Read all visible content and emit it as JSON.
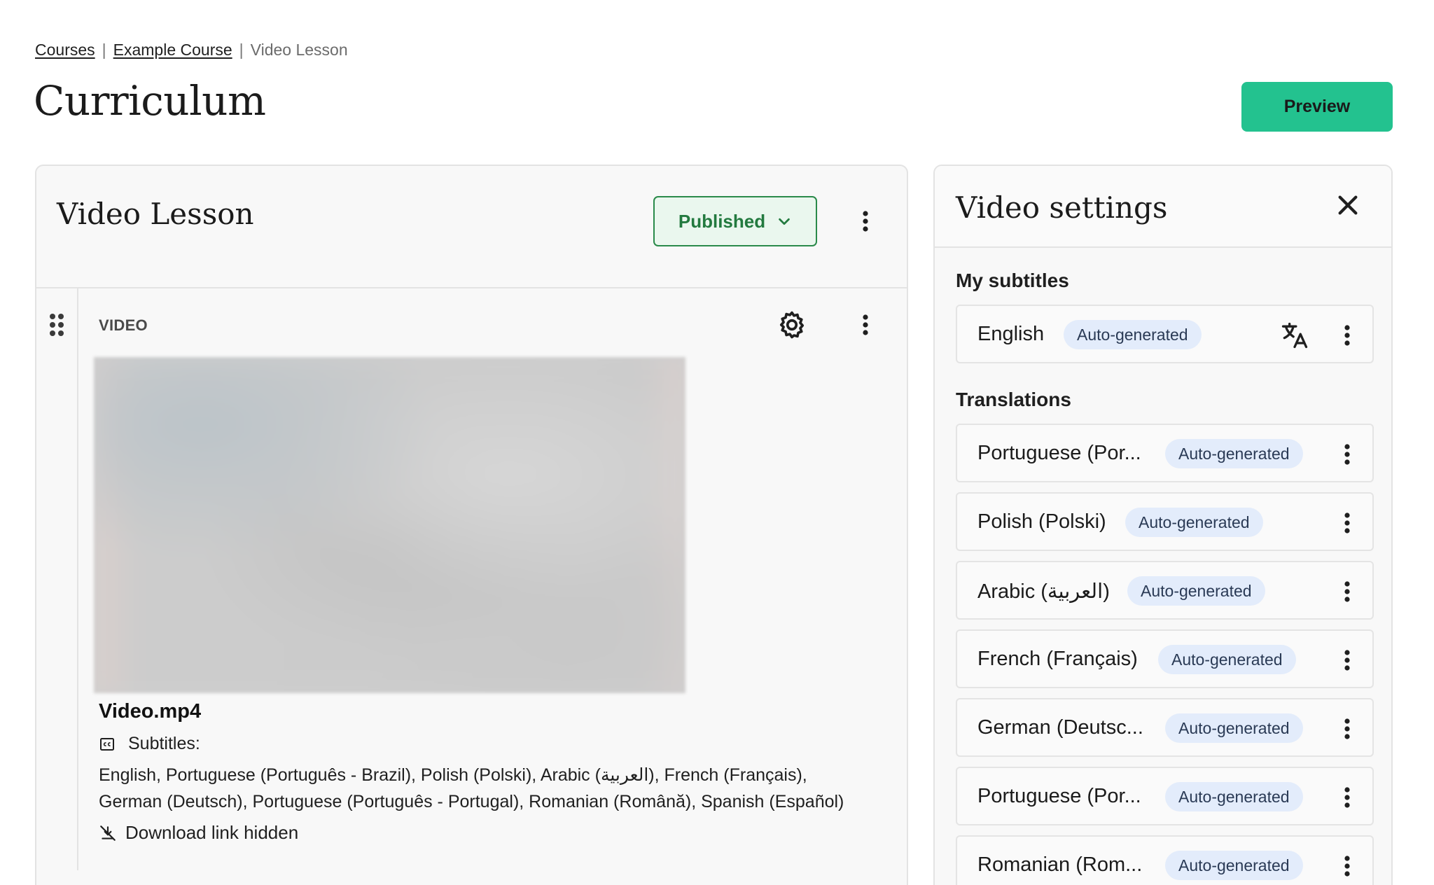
{
  "breadcrumb": {
    "items": [
      "Courses",
      "Example Course"
    ],
    "current": "Video Lesson",
    "separator": "|"
  },
  "page": {
    "title": "Curriculum",
    "preview_label": "Preview"
  },
  "lesson": {
    "title": "Video Lesson",
    "status_label": "Published",
    "block_type": "VIDEO",
    "file_name": "Video.mp4",
    "subtitles_label": "Subtitles:",
    "subtitles_line1": "English, Portuguese (Português - Brazil), Polish (Polski), Arabic (العربية), French (Français),",
    "subtitles_line2": "German (Deutsch), Portuguese (Português - Portugal), Romanian (Română), Spanish (Español)",
    "download_label": "Download link hidden"
  },
  "settings": {
    "title": "Video settings",
    "my_subtitles_heading": "My subtitles",
    "translations_heading": "Translations",
    "my_subtitles": [
      {
        "lang": "English",
        "badge": "Auto-generated"
      }
    ],
    "translations": [
      {
        "lang": "Portuguese (Por...",
        "badge": "Auto-generated"
      },
      {
        "lang": "Polish (Polski)",
        "badge": "Auto-generated"
      },
      {
        "lang": "Arabic (العربية)",
        "badge": "Auto-generated"
      },
      {
        "lang": "French (Français)",
        "badge": "Auto-generated"
      },
      {
        "lang": "German (Deutsc...",
        "badge": "Auto-generated"
      },
      {
        "lang": "Portuguese (Por...",
        "badge": "Auto-generated"
      },
      {
        "lang": "Romanian (Rom...",
        "badge": "Auto-generated"
      }
    ]
  },
  "icons": {
    "status_dropdown": "chevron-down-icon",
    "menu": "kebab-menu-icon",
    "drag": "drag-handle-icon",
    "settings": "gear-icon",
    "subtitles": "closed-captions-icon",
    "download_hidden": "download-off-icon",
    "close": "close-icon",
    "translate": "translate-icon"
  },
  "colors": {
    "accent": "#23c28f",
    "published_bg": "#eaf7ee",
    "published_border": "#2a8a4a",
    "published_text": "#237a3f",
    "badge_bg": "#e3ecfb"
  }
}
